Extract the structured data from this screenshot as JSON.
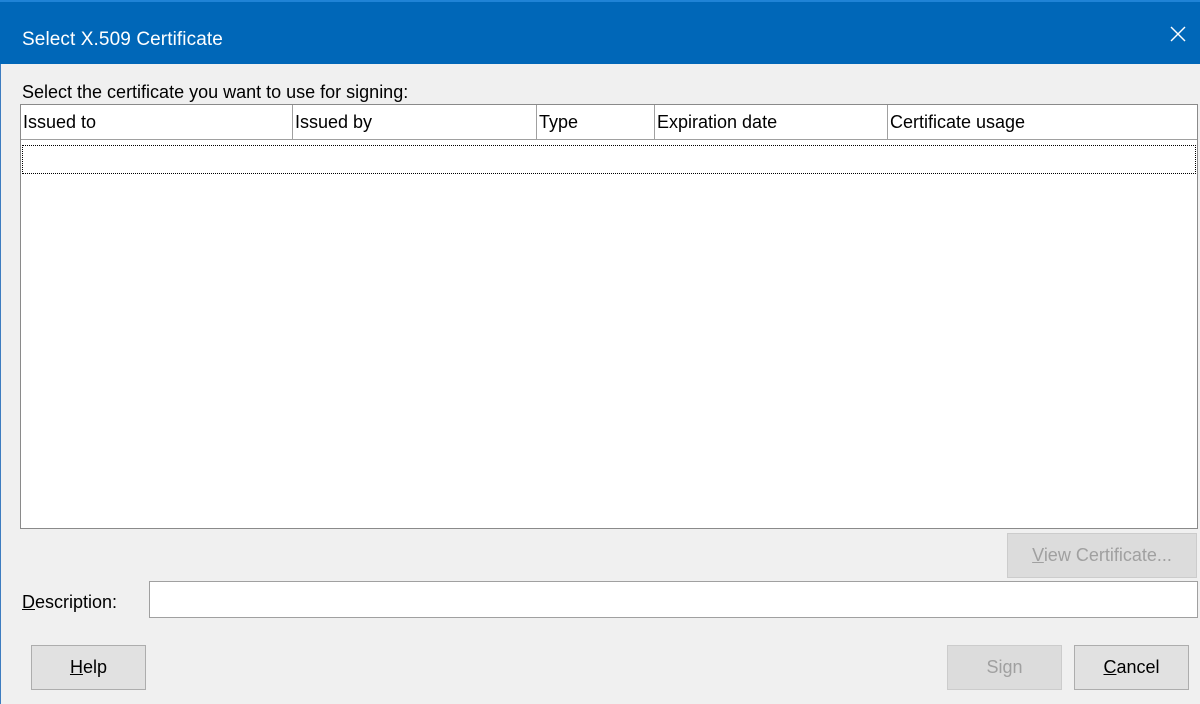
{
  "window": {
    "title": "Select X.509 Certificate",
    "close_label": "Close"
  },
  "prompt": "Select the certificate you want to use for signing:",
  "table": {
    "columns": [
      "Issued to",
      "Issued by",
      "Type",
      "Expiration date",
      "Certificate usage"
    ],
    "rows": []
  },
  "buttons": {
    "view_certificate": {
      "mnemonic": "V",
      "rest": "iew Certificate...",
      "enabled": false
    },
    "help": {
      "mnemonic": "H",
      "rest": "elp",
      "enabled": true
    },
    "sign": {
      "label": "Sign",
      "enabled": false
    },
    "cancel": {
      "mnemonic": "C",
      "rest": "ancel",
      "enabled": true
    }
  },
  "description": {
    "label_mnemonic": "D",
    "label_rest": "escription:",
    "value": ""
  },
  "icons": {
    "close": "close-icon"
  },
  "colors": {
    "titlebar": "#0067b8",
    "dialog_bg": "#f0f0f0",
    "disabled_text": "#a0a0a0"
  }
}
